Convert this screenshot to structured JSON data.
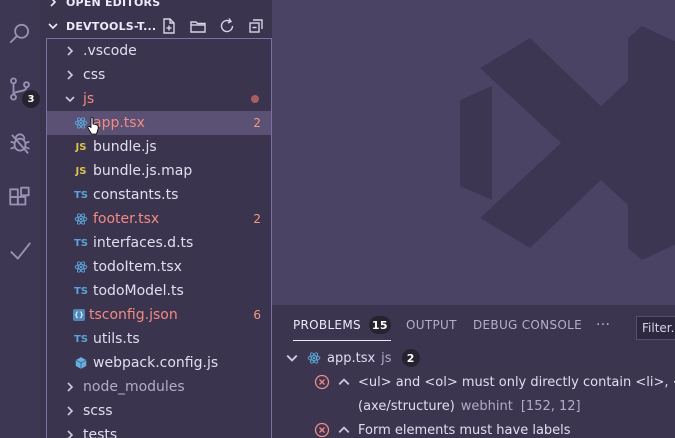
{
  "sidebar": {
    "open_editors_label": "OPEN EDITORS",
    "project_label": "DEVTOOLS-T...",
    "header_icons": [
      "new-file-icon",
      "new-folder-icon",
      "refresh-icon",
      "collapse-all-icon"
    ],
    "tree": [
      {
        "label": ".vscode",
        "type": "folder",
        "expanded": false
      },
      {
        "label": "css",
        "type": "folder",
        "expanded": false
      },
      {
        "label": "js",
        "type": "folder",
        "expanded": true,
        "error": true
      },
      {
        "label": "app.tsx",
        "type": "react",
        "count": "2",
        "error": true,
        "selected": true
      },
      {
        "label": "bundle.js",
        "type": "js",
        "icon_text": "JS"
      },
      {
        "label": "bundle.js.map",
        "type": "js",
        "icon_text": "JS"
      },
      {
        "label": "constants.ts",
        "type": "ts",
        "icon_text": "TS"
      },
      {
        "label": "footer.tsx",
        "type": "react",
        "count": "2",
        "error": true
      },
      {
        "label": "interfaces.d.ts",
        "type": "ts",
        "icon_text": "TS"
      },
      {
        "label": "todoItem.tsx",
        "type": "react"
      },
      {
        "label": "todoModel.ts",
        "type": "ts",
        "icon_text": "TS"
      },
      {
        "label": "tsconfig.json",
        "type": "json",
        "icon_text": "{}",
        "count": "6",
        "error": true
      },
      {
        "label": "utils.ts",
        "type": "ts",
        "icon_text": "TS"
      },
      {
        "label": "webpack.config.js",
        "type": "webpack"
      },
      {
        "label": "node_modules",
        "type": "folder",
        "expanded": false,
        "muted": true
      },
      {
        "label": "scss",
        "type": "folder",
        "expanded": false
      },
      {
        "label": "tests",
        "type": "folder",
        "expanded": false
      }
    ]
  },
  "activity_bar": {
    "icons": [
      "search-icon",
      "source-control-icon",
      "debug-icon",
      "extensions-icon",
      "check-icon"
    ],
    "source_control_badge": "3"
  },
  "panel": {
    "tabs": {
      "problems": "PROBLEMS",
      "problems_count": "15",
      "output": "OUTPUT",
      "debug_console": "DEBUG CONSOLE",
      "more": "···"
    },
    "filter_placeholder": "Filter. E.g.: text, **/*.ts, !**/node_modules/**",
    "file": {
      "name": "app.tsx",
      "lang": "js",
      "count": "2"
    },
    "problems": [
      {
        "message": "<ul> and <ol> must only directly contain <li>, <sc",
        "detail_rule": "(axe/structure)",
        "detail_source": "webhint",
        "detail_pos": "[152, 12]"
      },
      {
        "message": "Form elements must have labels"
      }
    ]
  },
  "colors": {
    "background": "#4b4363",
    "sidebar": "#3b344f",
    "activity_bar": "#3e3754",
    "error": "#f28b82",
    "selection": "#5a5174",
    "accent_border": "#7c70a3"
  }
}
